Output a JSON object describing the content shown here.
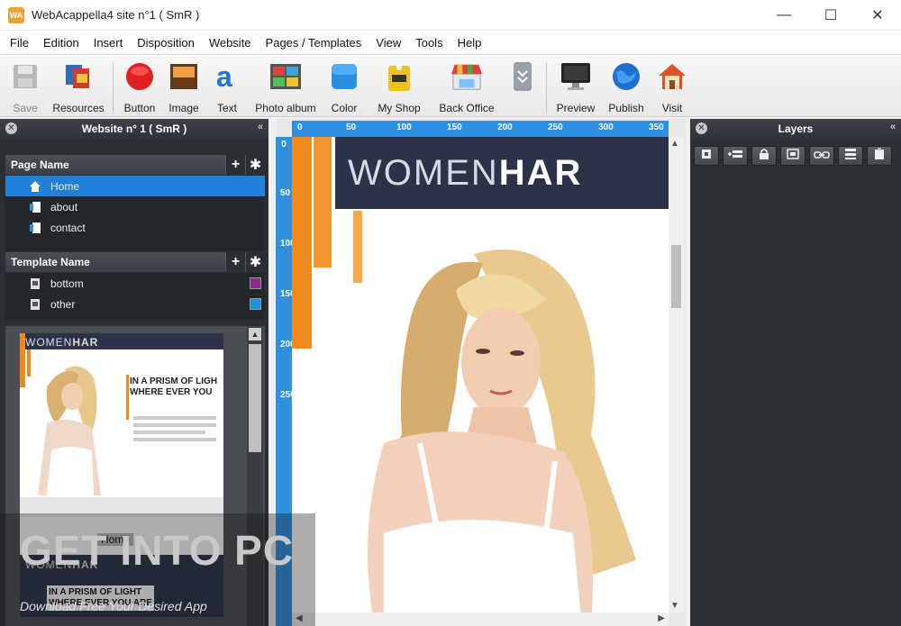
{
  "window": {
    "title": "WebAcappella4 site n°1 ( SmR )",
    "app_icon_text": "WA",
    "controls": {
      "minimize": "—",
      "maximize": "☐",
      "close": "✕"
    }
  },
  "menu": [
    "File",
    "Edition",
    "Insert",
    "Disposition",
    "Website",
    "Pages / Templates",
    "View",
    "Tools",
    "Help"
  ],
  "toolbar": {
    "save": "Save",
    "resources": "Resources",
    "button": "Button",
    "image": "Image",
    "text": "Text",
    "photo_album": "Photo album",
    "color": "Color",
    "my_shop": "My Shop",
    "back_office": "Back Office",
    "preview": "Preview",
    "publish": "Publish",
    "visit": "Visit"
  },
  "left_panel": {
    "title": "Website n° 1 ( SmR )",
    "pages_header": "Page Name",
    "pages": [
      {
        "label": "Home",
        "selected": true
      },
      {
        "label": "about",
        "selected": false
      },
      {
        "label": "contact",
        "selected": false
      }
    ],
    "templates_header": "Template Name",
    "templates": [
      {
        "label": "bottom",
        "color": "#8b2a8b"
      },
      {
        "label": "other",
        "color": "#1e90d8"
      }
    ],
    "thumbnail": {
      "logo_light": "WOMEN",
      "logo_bold": "HAR",
      "headline_1": "IN A PRISM OF LIGH",
      "headline_2": "WHERE EVER YOU",
      "label": "Home",
      "footer_1": "IN A PRISM OF LIGHT",
      "footer_2": "WHERE EVER YOU ARE"
    }
  },
  "canvas": {
    "ruler_top": [
      "0",
      "50",
      "100",
      "150",
      "200",
      "250",
      "300",
      "350"
    ],
    "ruler_left": [
      "0",
      "50",
      "100",
      "150",
      "200",
      "250"
    ],
    "logo_light": "WOMEN",
    "logo_bold": "HAR"
  },
  "right_panel": {
    "title": "Layers"
  },
  "watermark": {
    "title": "GET INTO PC",
    "subtitle": "Download Free Your Desired App"
  },
  "colors": {
    "selection": "#1f7fd9",
    "ruler": "#2f8fe0",
    "accent_orange": "#f08a1c",
    "header_navy": "#2c3349"
  }
}
